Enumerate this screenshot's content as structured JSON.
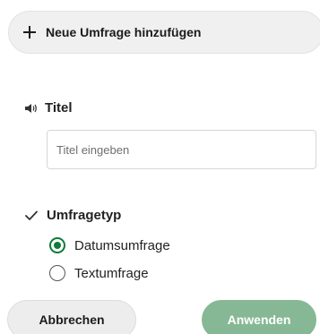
{
  "add_poll": {
    "label": "Neue Umfrage hinzufügen",
    "icon": "plus-icon"
  },
  "title_section": {
    "heading": "Titel",
    "icon": "speaker-icon",
    "input_placeholder": "Titel eingeben",
    "input_value": ""
  },
  "type_section": {
    "heading": "Umfragetyp",
    "icon": "check-icon",
    "options": [
      {
        "label": "Datumsumfrage",
        "selected": true
      },
      {
        "label": "Textumfrage",
        "selected": false
      }
    ]
  },
  "actions": {
    "cancel_label": "Abbrechen",
    "apply_label": "Anwenden"
  },
  "colors": {
    "accent": "#0f7a39",
    "apply_disabled": "#86b895",
    "pill_background": "#f0f0f0"
  }
}
